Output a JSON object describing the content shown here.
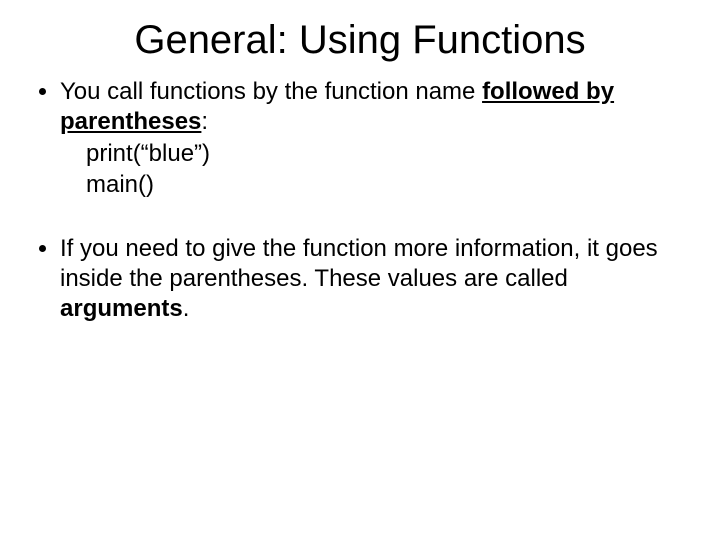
{
  "title": "General: Using Functions",
  "bullet1": {
    "part1": "You call functions by the function name ",
    "underlined": "followed by parentheses",
    "part2": ":",
    "code1": "print(“blue”)",
    "code2": "main()"
  },
  "bullet2": {
    "part1": "If you need to give the function more information, it goes inside the parentheses.  These values are called ",
    "bold": "arguments",
    "part2": "."
  }
}
